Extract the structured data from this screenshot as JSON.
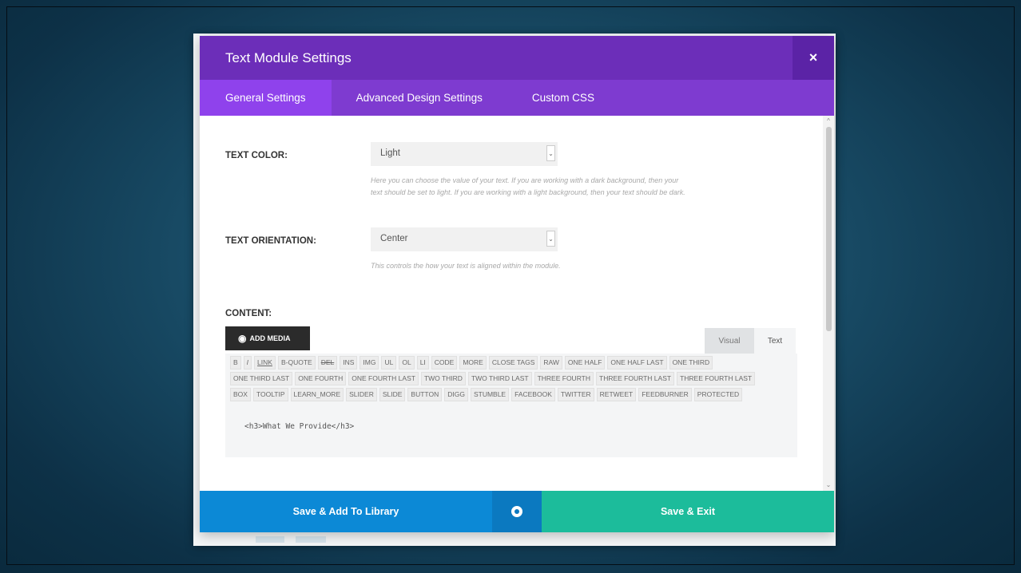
{
  "modal": {
    "title": "Text Module Settings",
    "close_icon": "×"
  },
  "tabs": [
    {
      "label": "General Settings",
      "active": true
    },
    {
      "label": "Advanced Design Settings",
      "active": false
    },
    {
      "label": "Custom CSS",
      "active": false
    }
  ],
  "fields": {
    "text_color": {
      "label": "TEXT COLOR:",
      "value": "Light",
      "description_1": "Here you can choose the value of your text. If you are working with a dark background, then your",
      "description_2": "text should be set to light. If you are working with a light background, then your text should be dark."
    },
    "text_orientation": {
      "label": "TEXT ORIENTATION:",
      "value": "Center",
      "description": "This controls the how your text is aligned within the module."
    },
    "content": {
      "label": "CONTENT:",
      "add_media": "ADD MEDIA",
      "editor_tabs": [
        "Visual",
        "Text"
      ],
      "quicktags_row1": [
        "B",
        "I",
        "LINK",
        "B-QUOTE",
        "DEL",
        "INS",
        "IMG",
        "UL",
        "OL",
        "LI",
        "CODE",
        "MORE",
        "CLOSE TAGS",
        "RAW",
        "ONE HALF",
        "ONE HALF LAST",
        "ONE THIRD"
      ],
      "quicktags_row2": [
        "ONE THIRD LAST",
        "ONE FOURTH",
        "ONE FOURTH LAST",
        "TWO THIRD",
        "TWO THIRD LAST",
        "THREE FOURTH",
        "THREE FOURTH LAST",
        "THREE FOURTH LAST"
      ],
      "quicktags_row3": [
        "BOX",
        "TOOLTIP",
        "LEARN_MORE",
        "SLIDER",
        "SLIDE",
        "BUTTON",
        "DIGG",
        "STUMBLE",
        "FACEBOOK",
        "TWITTER",
        "RETWEET",
        "FEEDBURNER",
        "PROTECTED"
      ],
      "editor_value": "<h3>What We Provide</h3>"
    }
  },
  "footer": {
    "save_library": "Save & Add To Library",
    "preview_icon": "eye-icon",
    "save_exit": "Save & Exit"
  },
  "colors": {
    "title_bar": "#6c2eb9",
    "tabs_bar": "#7e3bd0",
    "save_library": "#0c89d6",
    "save_exit": "#1cbc9b"
  }
}
